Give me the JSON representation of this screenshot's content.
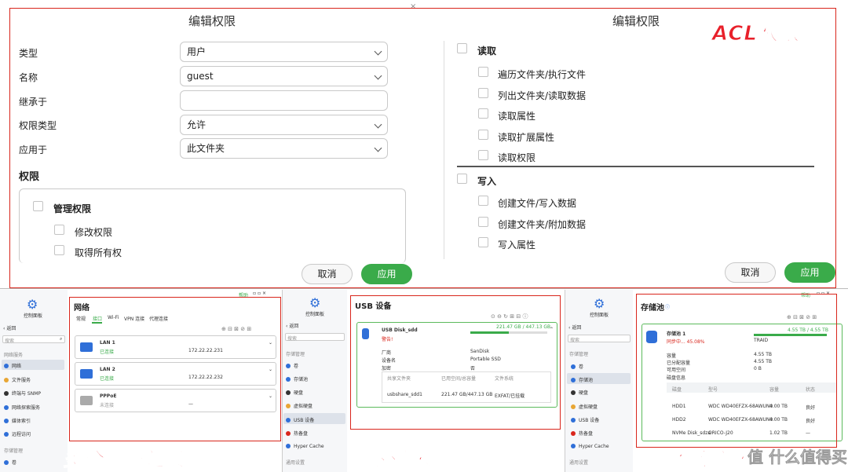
{
  "acl": {
    "left_title": "编辑权限",
    "right_title": "编辑权限",
    "slogan": "ACL权限",
    "fields": [
      {
        "label": "类型",
        "value": "用户",
        "dropdown": true
      },
      {
        "label": "名称",
        "value": "guest",
        "dropdown": true
      },
      {
        "label": "继承于",
        "value": "",
        "dropdown": false
      },
      {
        "label": "权限类型",
        "value": "允许",
        "dropdown": true
      },
      {
        "label": "应用于",
        "value": "此文件夹",
        "dropdown": true
      }
    ],
    "perm_heading": "权限",
    "admin_group": "管理权限",
    "admin_items": [
      "修改权限",
      "取得所有权"
    ],
    "read_group": "读取",
    "read_items": [
      "遍历文件夹/执行文件",
      "列出文件夹/读取数据",
      "读取属性",
      "读取扩展属性",
      "读取权限"
    ],
    "write_group": "写入",
    "write_items": [
      "创建文件/写入数据",
      "创建文件夹/附加数据",
      "写入属性"
    ],
    "cancel": "取消",
    "apply": "应用"
  },
  "net": {
    "help": "帮助",
    "control_panel": "控制面板",
    "back": "返回",
    "search": "搜索",
    "section": "网络服务",
    "side": [
      "网络",
      "文件服务",
      "终端与 SNMP",
      "网络探索服务",
      "媒体索引",
      "远程访问"
    ],
    "side2": "存储管理",
    "side3": "卷",
    "title": "网络",
    "tabs": [
      "常规",
      "接口",
      "Wi-Fi",
      "VPN 连接",
      "代理连接"
    ],
    "rows": [
      {
        "name": "LAN 1",
        "status": "已连接",
        "ip": "172.22.22.231"
      },
      {
        "name": "LAN 2",
        "status": "已连接",
        "ip": "172.22.22.232"
      },
      {
        "name": "PPPoE",
        "status": "未连接",
        "ip": "—"
      }
    ],
    "slogan": "多个网络连接"
  },
  "usb": {
    "control_panel": "控制面板",
    "back": "返回",
    "search": "搜索",
    "section": "存储管理",
    "side": [
      "卷",
      "存储池",
      "硬盘",
      "虚拟硬盘",
      "USB 设备",
      "热备盘",
      "Hyper Cache"
    ],
    "side_tail": "通用设置",
    "title": "USB 设备",
    "device": "USB Disk_sdd",
    "warning": "警告!",
    "usage": "221.47 GB / 447.13 GB",
    "usage_ratio": 0.495,
    "props": [
      {
        "k": "厂商",
        "v": "SanDisk"
      },
      {
        "k": "设备名",
        "v": "Portable SSD"
      },
      {
        "k": "加密",
        "v": "否"
      }
    ],
    "table_head": [
      "共享文件夹",
      "已用空间/总容量",
      "文件系统"
    ],
    "table_row": [
      "usbshare_sdd1",
      "221.47 GB/447.13 GB",
      "EXFAT/已挂载"
    ],
    "slogan": "外部硬盘直插"
  },
  "pool": {
    "help": "帮助",
    "control_panel": "控制面板",
    "back": "返回",
    "search": "搜索",
    "section": "存储管理",
    "side": [
      "卷",
      "存储池",
      "硬盘",
      "虚拟硬盘",
      "USB 设备",
      "热备盘",
      "Hyper Cache"
    ],
    "side_tail": "通用设置",
    "title": "存储池",
    "pool_name": "存储池 1",
    "syncing": "同步中... 45.08%",
    "capacity_text": "4.55 TB / 4.55 TB",
    "capacity_ratio": 1.0,
    "raid": "TRAID",
    "props": [
      {
        "k": "容量",
        "v": "4.55 TB"
      },
      {
        "k": "已分配容量",
        "v": "4.55 TB"
      },
      {
        "k": "可用空间",
        "v": "0 B"
      }
    ],
    "disk_info": "磁盘信息",
    "table_head": [
      "磁盘",
      "型号",
      "容量",
      "状态"
    ],
    "disks": [
      [
        "HDD1",
        "WDC WD40EFZX-68AWUN0",
        "4.00 TB",
        "良好"
      ],
      [
        "HDD2",
        "WDC WD40EFZX-68AWUN0",
        "4.00 TB",
        "良好"
      ],
      [
        "NVMe Disk_sdza",
        "ORICO-J20",
        "1.02 TB",
        "—"
      ]
    ],
    "slogan": "存储池迁移",
    "watermark": "值 什么值得买"
  },
  "colors": {
    "accent": "#3aab4a",
    "highlight": "#d9261c",
    "link": "#2f6fd8"
  }
}
